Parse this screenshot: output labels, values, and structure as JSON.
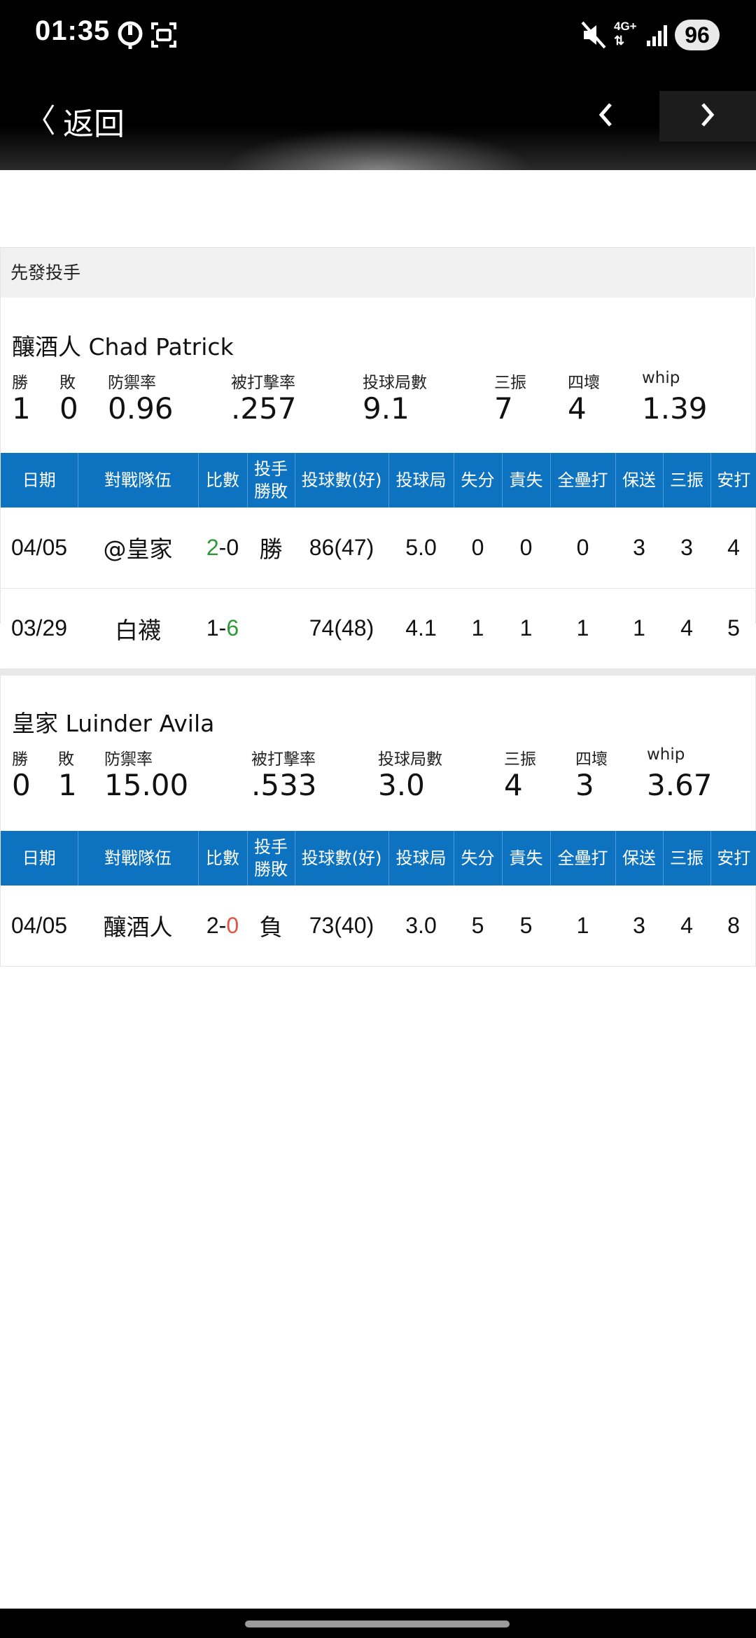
{
  "status_bar": {
    "time": "01:35",
    "battery": "96",
    "network": "4G+"
  },
  "nav": {
    "back_label": "返回"
  },
  "section_title": "先發投手",
  "stat_labels": {
    "wins": "勝",
    "losses": "敗",
    "era": "防禦率",
    "avg": "被打擊率",
    "ip": "投球局數",
    "so": "三振",
    "bb": "四壞",
    "whip": "whip"
  },
  "table_headers": [
    "日期",
    "對戰隊伍",
    "比數",
    "投手勝敗",
    "投球數(好)",
    "投球局",
    "失分",
    "責失",
    "全壘打",
    "保送",
    "三振",
    "安打"
  ],
  "pitchers": [
    {
      "name": "釀酒人 Chad Patrick",
      "stats": {
        "wins": "1",
        "losses": "0",
        "era": "0.96",
        "avg": ".257",
        "ip": "9.1",
        "so": "7",
        "bb": "4",
        "whip": "1.39"
      },
      "games": [
        {
          "date": "04/05",
          "opponent": "@皇家",
          "score_a": "2",
          "score_b": "0",
          "winner_side": "a",
          "result": "勝",
          "result_type": "win",
          "pitches": "86(47)",
          "ip": "5.0",
          "r": "0",
          "er": "0",
          "hr": "0",
          "bb": "3",
          "so": "3",
          "h": "4"
        },
        {
          "date": "03/29",
          "opponent": "白襪",
          "score_a": "1",
          "score_b": "6",
          "winner_side": "b",
          "result": "",
          "result_type": "none",
          "pitches": "74(48)",
          "ip": "4.1",
          "r": "1",
          "er": "1",
          "hr": "1",
          "bb": "1",
          "so": "4",
          "h": "5"
        }
      ]
    },
    {
      "name": "皇家 Luinder Avila",
      "stats": {
        "wins": "0",
        "losses": "1",
        "era": "15.00",
        "avg": ".533",
        "ip": "3.0",
        "so": "4",
        "bb": "3",
        "whip": "3.67"
      },
      "games": [
        {
          "date": "04/05",
          "opponent": "釀酒人",
          "score_a": "2",
          "score_b": "0",
          "winner_side": "b_loss",
          "result": "負",
          "result_type": "loss",
          "pitches": "73(40)",
          "ip": "3.0",
          "r": "5",
          "er": "5",
          "hr": "1",
          "bb": "3",
          "so": "4",
          "h": "8"
        }
      ]
    }
  ]
}
